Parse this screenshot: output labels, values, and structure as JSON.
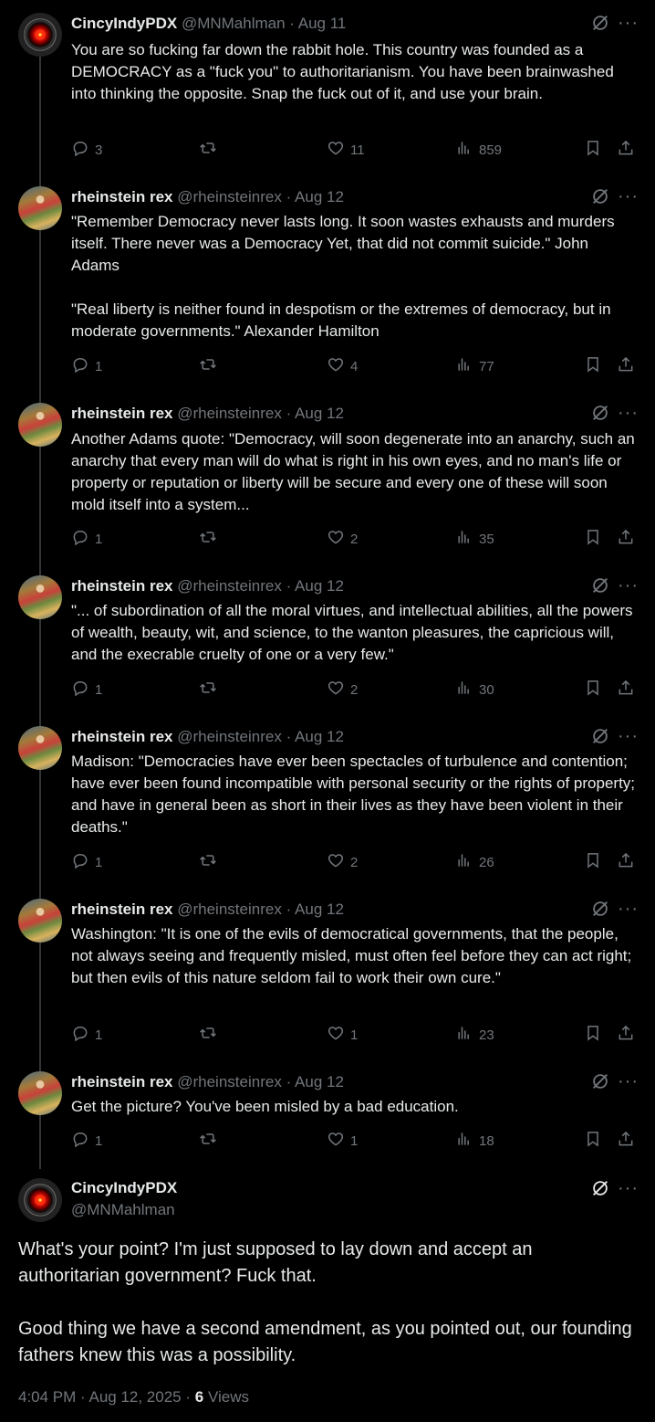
{
  "replies": [
    {
      "name": "CincyIndyPDX",
      "handle": "@MNMahlman",
      "date": "Aug 11",
      "avatar": "hal",
      "text": "You are so fucking far down the rabbit hole. This country was founded as a DEMOCRACY as a \"fuck you\" to authoritarianism. You have been brainwashed into thinking the opposite. Snap the fuck out of it, and use your brain.",
      "replies": "3",
      "reposts": "",
      "likes": "11",
      "views": "859"
    },
    {
      "name": "rheinstein rex",
      "handle": "@rheinsteinrex",
      "date": "Aug 12",
      "avatar": "ornate",
      "text": "\"Remember Democracy never lasts long. It soon wastes exhausts and murders itself. There never was a Democracy Yet, that did not commit suicide.\" John Adams\n\n\"Real liberty is neither found in despotism or the extremes of democracy, but in moderate governments.\" Alexander Hamilton",
      "replies": "1",
      "reposts": "",
      "likes": "4",
      "views": "77"
    },
    {
      "name": "rheinstein rex",
      "handle": "@rheinsteinrex",
      "date": "Aug 12",
      "avatar": "ornate",
      "text": "Another Adams quote: \"Democracy, will soon degenerate into an anarchy, such an anarchy that every man will do what is right in his own eyes, and no man's life or property or reputation or liberty will be secure and every one of these will soon mold itself into a system...",
      "replies": "1",
      "reposts": "",
      "likes": "2",
      "views": "35"
    },
    {
      "name": "rheinstein rex",
      "handle": "@rheinsteinrex",
      "date": "Aug 12",
      "avatar": "ornate",
      "text": "\"... of subordination of all the moral virtues, and intellectual abilities, all the powers of wealth, beauty, wit, and science, to the wanton pleasures, the capricious will, and the execrable cruelty of one or a very few.\"",
      "replies": "1",
      "reposts": "",
      "likes": "2",
      "views": "30"
    },
    {
      "name": "rheinstein rex",
      "handle": "@rheinsteinrex",
      "date": "Aug 12",
      "avatar": "ornate",
      "text": "Madison: \"Democracies have ever been spectacles of turbulence and contention; have ever been found incompatible with personal security or the rights of property; and have in general been as short in their lives as they have been violent in their deaths.\"",
      "replies": "1",
      "reposts": "",
      "likes": "2",
      "views": "26"
    },
    {
      "name": "rheinstein rex",
      "handle": "@rheinsteinrex",
      "date": "Aug 12",
      "avatar": "ornate",
      "text": "Washington: \"It is one of the evils of democratical governments, that the people, not always seeing and frequently misled, must often feel before they can act right; but then evils of this nature seldom fail to work their own cure.\"",
      "replies": "1",
      "reposts": "",
      "likes": "1",
      "views": "23"
    },
    {
      "name": "rheinstein rex",
      "handle": "@rheinsteinrex",
      "date": "Aug 12",
      "avatar": "ornate",
      "text": "Get the picture? You've been misled by a bad education.",
      "replies": "1",
      "reposts": "",
      "likes": "1",
      "views": "18"
    }
  ],
  "main": {
    "name": "CincyIndyPDX",
    "handle": "@MNMahlman",
    "avatar": "hal",
    "text": "What's your point? I'm just supposed to lay down and accept an authoritarian government? Fuck that.\n\nGood thing we have a second amendment, as you pointed out, our founding fathers knew this was a possibility.",
    "time": "4:04 PM · Aug 12, 2025 · ",
    "views_count": "6",
    "views_label": "Views"
  },
  "colors": {
    "background": "#000000",
    "text": "#e7e9ea",
    "muted": "#71767b",
    "thread_line": "#333639"
  },
  "icons": [
    "reply-icon",
    "repost-icon",
    "like-icon",
    "views-icon",
    "bookmark-icon",
    "share-icon",
    "grok-icon",
    "more-icon"
  ]
}
